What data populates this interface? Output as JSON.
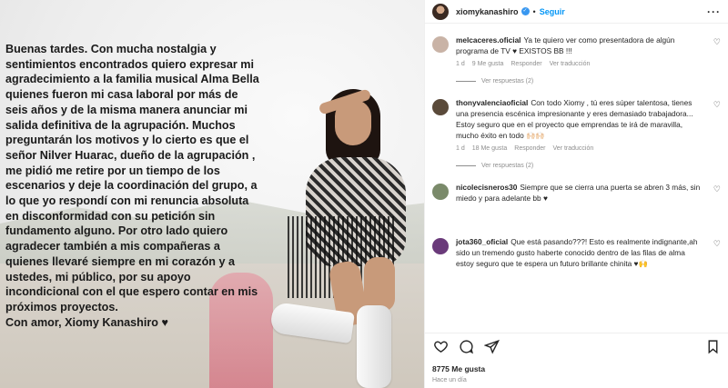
{
  "post": {
    "caption": "Buenas tardes. Con mucha nostalgia y\nsentimientos encontrados quiero expresar mi\nagradecimiento a la familia musical Alma Bella\nquienes fueron mi casa laboral por más de\nseis  años y de la misma manera anunciar mi\nsalida definitiva de la agrupación. Muchos\npreguntarán los motivos y lo cierto es que el\nseñor Nilver Huarac, dueño de la agrupación ,\nme pidió me retire por un tiempo de los\nescenarios y deje la coordinación del grupo, a\nlo que yo respondí con mi renuncia absoluta\nen disconformidad con su petición sin\nfundamento alguno. Por otro lado quiero\nagradecer  también a mis compañeras a\nquienes llevaré siempre en mi corazón y a\nustedes, mi público, por su apoyo\nincondicional con el que espero contar en mis\npróximos proyectos.\nCon amor, Xiomy Kanashiro ♥"
  },
  "header": {
    "username": "xiomykanashiro",
    "separator": "•",
    "follow_label": "Seguir",
    "more_label": "···"
  },
  "comments": [
    {
      "username": "melcaceres.oficial",
      "text": "Ya te quiero ver como presentadora de algún programa de TV ♥ EXISTOS BB !!!",
      "time": "1 d",
      "likes": "9 Me gusta",
      "reply": "Responder",
      "translate": "Ver traducción",
      "view_replies": "Ver respuestas (2)",
      "avatar_color": "#c9b3a6"
    },
    {
      "username": "thonyvalenciaoficial",
      "text": "Con todo Xiomy , tú eres súper talentosa, tienes una presencia escénica impresionante y eres demasiado trabajadora... Estoy seguro que en el proyecto que emprendas te irá de maravilla, mucho éxito en todo 🙌🏻🙌🏻",
      "time": "1 d",
      "likes": "18 Me gusta",
      "reply": "Responder",
      "translate": "Ver traducción",
      "view_replies": "Ver respuestas (2)",
      "avatar_color": "#5a4a3a"
    },
    {
      "username": "nicolecisneros30",
      "text": "Siempre que se cierra una puerta se abren 3 más, sin miedo y para adelante bb ♥",
      "time": "",
      "likes": "",
      "reply": "",
      "translate": "",
      "view_replies": "",
      "avatar_color": "#7a8a6a"
    },
    {
      "username": "jota360_oficial",
      "text": "Que está pasando???! Esto es realmente indignante,ah sido un tremendo gusto haberte conocido dentro de las filas de alma estoy seguro que te espera un futuro brillante chinita ♥🙌",
      "time": "",
      "likes": "",
      "reply": "",
      "translate": "",
      "view_replies": "",
      "avatar_color": "#6a3a7a"
    }
  ],
  "footer": {
    "likes": "8775 Me gusta",
    "time_ago": "Hace un día"
  },
  "icons": [
    "verified-icon",
    "heart-icon",
    "comment-icon",
    "share-icon",
    "bookmark-icon",
    "more-icon"
  ],
  "colors": {
    "link": "#0095f6",
    "verified": "#3897f0",
    "muted": "#8e8e8e",
    "text": "#262626"
  }
}
